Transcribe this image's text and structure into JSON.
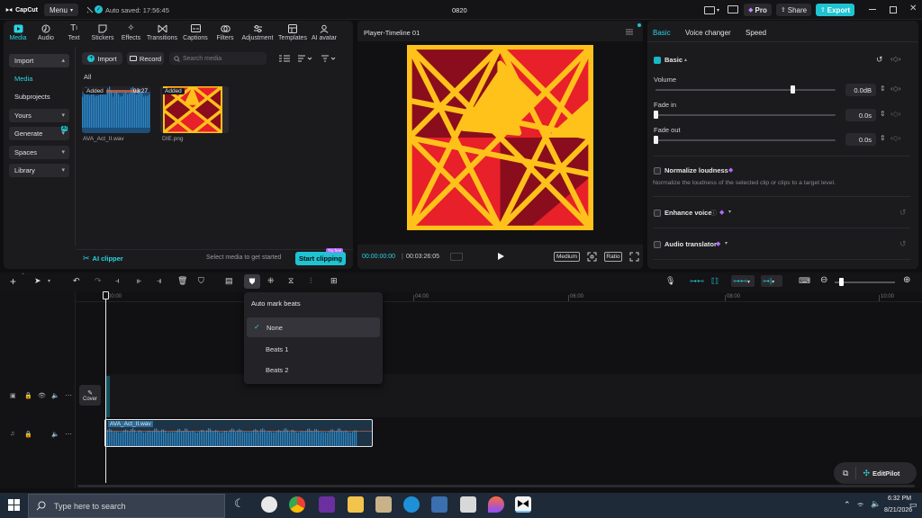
{
  "window": {
    "app_name": "CapCut",
    "menu_label": "Menu",
    "autosave": "Auto saved: 17:56:45",
    "project_title": "0820",
    "pro_label": "Pro",
    "share_label": "Share",
    "export_label": "Export"
  },
  "toolbar": {
    "tools": [
      {
        "label": "Media",
        "icon": "media-icon",
        "active": true
      },
      {
        "label": "Audio",
        "icon": "audio-icon"
      },
      {
        "label": "Text",
        "icon": "text-icon"
      },
      {
        "label": "Stickers",
        "icon": "stickers-icon"
      },
      {
        "label": "Effects",
        "icon": "effects-icon"
      },
      {
        "label": "Transitions",
        "icon": "transitions-icon"
      },
      {
        "label": "Captions",
        "icon": "captions-icon"
      },
      {
        "label": "Filters",
        "icon": "filters-icon"
      },
      {
        "label": "Adjustment",
        "icon": "adjustment-icon"
      },
      {
        "label": "Templates",
        "icon": "templates-icon"
      },
      {
        "label": "AI avatar",
        "icon": "ai-avatar-icon"
      }
    ]
  },
  "sidebar": {
    "import": "Import",
    "media": "Media",
    "subprojects": "Subprojects",
    "yours": "Yours",
    "generate": "Generate",
    "spaces": "Spaces",
    "library": "Library",
    "ai_badge": "AI"
  },
  "media_panel": {
    "import_button": "Import",
    "record_button": "Record",
    "search_placeholder": "Search media",
    "all_label": "All",
    "items": [
      {
        "name": "AVA_Act_II.wav",
        "badge": "Added",
        "duration": "03:27"
      },
      {
        "name": "DIE.png",
        "badge": "Added"
      }
    ],
    "ai_clipper": "AI clipper",
    "hint": "Select media to get started",
    "start_clipping": "Start clipping",
    "try_free": "Try free"
  },
  "player": {
    "title": "Player-Timeline 01",
    "current_time": "00:00:00:00",
    "total_time": "00:03:26:05",
    "quality": "Medium",
    "ratio": "Ratio"
  },
  "inspector": {
    "tabs": [
      "Basic",
      "Voice changer",
      "Speed"
    ],
    "section": "Basic",
    "volume_label": "Volume",
    "volume_value": "0.0dB",
    "volume_level": 0.78,
    "fade_in_label": "Fade in",
    "fade_in_value": "0.0s",
    "fade_out_label": "Fade out",
    "fade_out_value": "0.0s",
    "normalize_label": "Normalize loudness",
    "normalize_desc": "Normalize the loudness of the selected clip or clips to a target level.",
    "enhance_label": "Enhance voice",
    "translator_label": "Audio translator"
  },
  "timeline": {
    "ruler": [
      "00:00",
      "04:00",
      "06:00",
      "08:00",
      "10:00"
    ],
    "cover_label": "Cover",
    "audio_clip": "AVA_Act_II.wav",
    "menu_title": "Auto mark beats",
    "menu_items": [
      "None",
      "Beats 1",
      "Beats 2"
    ],
    "selected_item": "None",
    "editpilot": "EditPilot"
  },
  "taskbar": {
    "search_placeholder": "Type here to search",
    "time": "6:32 PM",
    "date": "8/21/2026"
  },
  "colors": {
    "accent": "#1fc3d1",
    "bg": "#0f0f11",
    "panel": "#1b1b1e",
    "art_red": "#e8202a",
    "art_dark": "#8a0d1d",
    "art_yellow": "#ffc21a",
    "clip_blue": "#1f6fa6"
  }
}
